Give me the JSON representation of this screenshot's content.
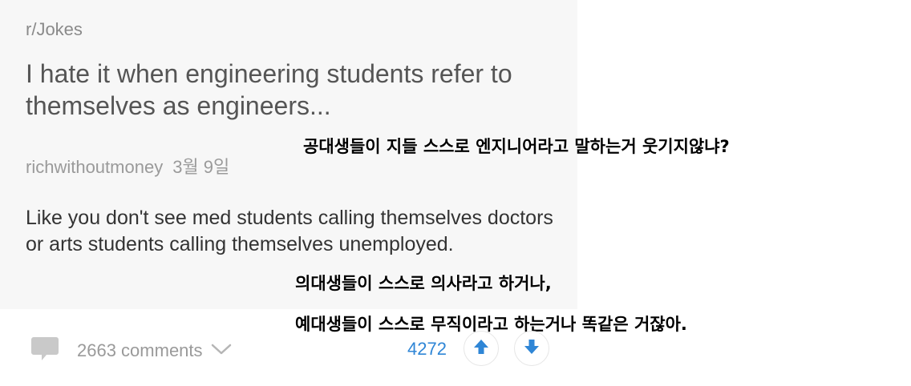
{
  "post": {
    "subreddit": "r/Jokes",
    "title": "I hate it when engineering students refer to themselves as engineers...",
    "author": "richwithoutmoney",
    "date": "3월 9일",
    "body": "Like you don't see med students calling themselves doctors or arts students calling themselves unemployed."
  },
  "subtitles": {
    "line1": "공대생들이 지들 스스로 엔지니어라고 말하는거 웃기지않냐?",
    "line2": "의대생들이 스스로 의사라고 하거나,",
    "line3": "예대생들이 스스로 무직이라고 하는거나 똑같은 거잖아."
  },
  "footer": {
    "comments_label": "2663 comments",
    "score": "4272",
    "icons": {
      "comment": "comment-bubble-icon",
      "expand": "chevron-down-icon",
      "upvote": "arrow-up-icon",
      "downvote": "arrow-down-icon"
    },
    "colors": {
      "score": "#2f86d6",
      "arrows": "#2f86d6",
      "muted": "#9a9a9a"
    }
  }
}
